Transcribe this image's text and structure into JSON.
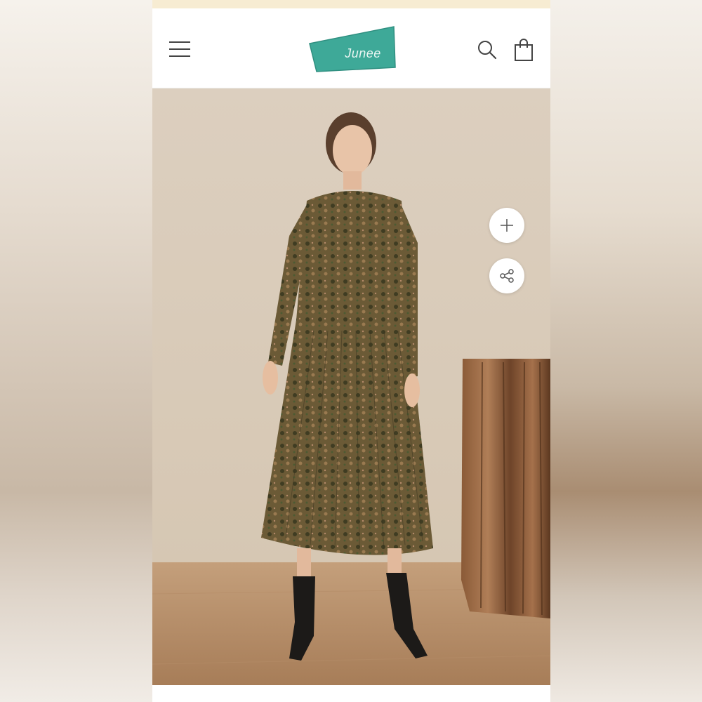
{
  "header": {
    "brand": "Junee",
    "menu_icon": "hamburger-menu-icon",
    "search_icon": "search-icon",
    "cart_icon": "shopping-bag-icon",
    "brand_color": "#3ea998"
  },
  "product_image": {
    "zoom_icon": "plus-icon",
    "share_icon": "share-icon",
    "dress_color": "#6b5a36",
    "backdrop_color": "#d9cbb8",
    "floor_color": "#b48e68"
  },
  "colors": {
    "announcement_bar": "#f7ecd2",
    "background": "#ffffff"
  }
}
